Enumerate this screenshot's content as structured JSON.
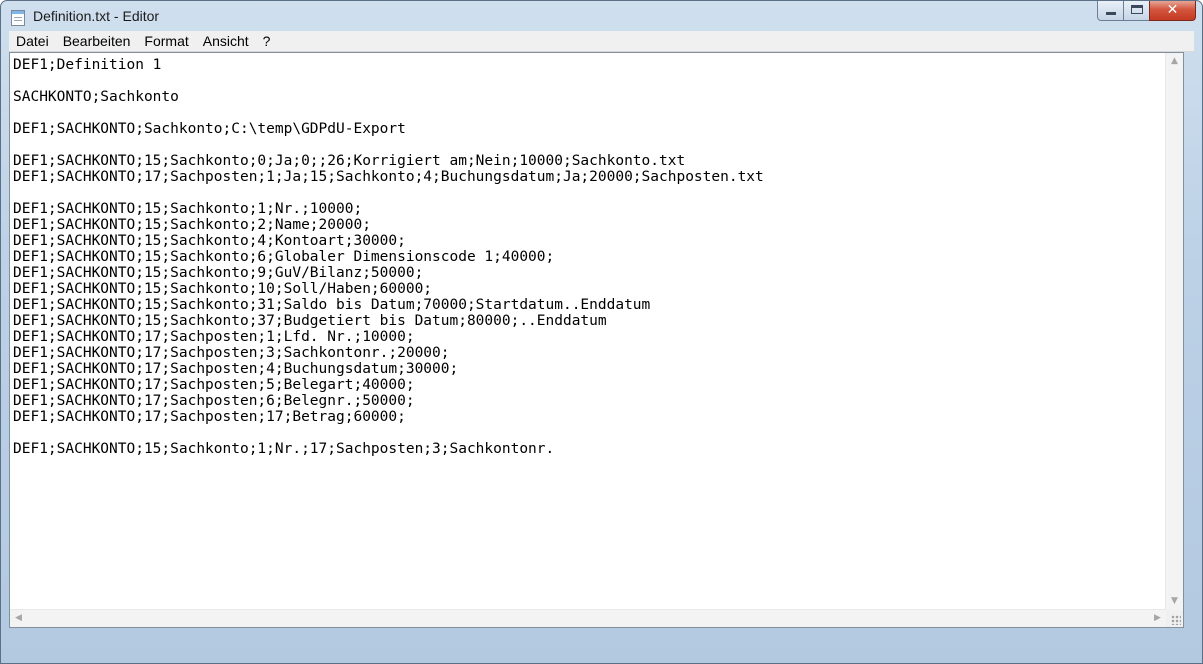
{
  "window": {
    "title": "Definition.txt - Editor",
    "close_glyph": "✕"
  },
  "menu": [
    "Datei",
    "Bearbeiten",
    "Format",
    "Ansicht",
    "?"
  ],
  "content": {
    "lines": [
      "DEF1;Definition 1",
      "",
      "SACHKONTO;Sachkonto",
      "",
      "DEF1;SACHKONTO;Sachkonto;C:\\temp\\GDPdU-Export",
      "",
      "DEF1;SACHKONTO;15;Sachkonto;0;Ja;0;;26;Korrigiert am;Nein;10000;Sachkonto.txt",
      "DEF1;SACHKONTO;17;Sachposten;1;Ja;15;Sachkonto;4;Buchungsdatum;Ja;20000;Sachposten.txt",
      "",
      "DEF1;SACHKONTO;15;Sachkonto;1;Nr.;10000;",
      "DEF1;SACHKONTO;15;Sachkonto;2;Name;20000;",
      "DEF1;SACHKONTO;15;Sachkonto;4;Kontoart;30000;",
      "DEF1;SACHKONTO;15;Sachkonto;6;Globaler Dimensionscode 1;40000;",
      "DEF1;SACHKONTO;15;Sachkonto;9;GuV/Bilanz;50000;",
      "DEF1;SACHKONTO;15;Sachkonto;10;Soll/Haben;60000;",
      "DEF1;SACHKONTO;15;Sachkonto;31;Saldo bis Datum;70000;Startdatum..Enddatum",
      "DEF1;SACHKONTO;15;Sachkonto;37;Budgetiert bis Datum;80000;..Enddatum",
      "DEF1;SACHKONTO;17;Sachposten;1;Lfd. Nr.;10000;",
      "DEF1;SACHKONTO;17;Sachposten;3;Sachkontonr.;20000;",
      "DEF1;SACHKONTO;17;Sachposten;4;Buchungsdatum;30000;",
      "DEF1;SACHKONTO;17;Sachposten;5;Belegart;40000;",
      "DEF1;SACHKONTO;17;Sachposten;6;Belegnr.;50000;",
      "DEF1;SACHKONTO;17;Sachposten;17;Betrag;60000;",
      "",
      "DEF1;SACHKONTO;15;Sachkonto;1;Nr.;17;Sachposten;3;Sachkontonr."
    ]
  },
  "scrollbar": {
    "up_glyph": "▲",
    "down_glyph": "▼",
    "left_glyph": "◀",
    "right_glyph": "▶"
  }
}
